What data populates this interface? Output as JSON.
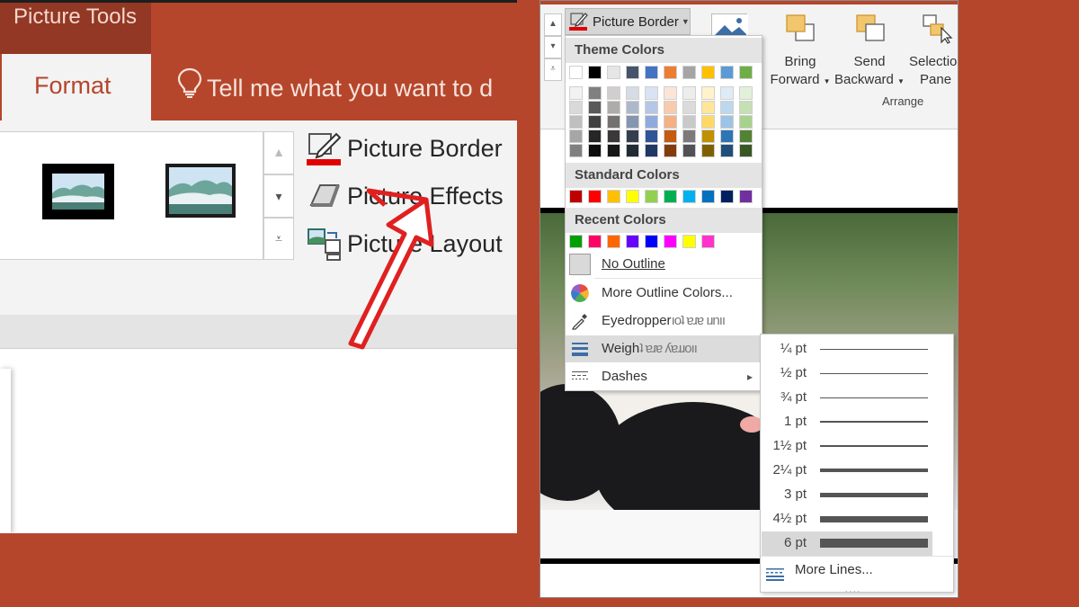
{
  "colors": {
    "accent": "#b5462b",
    "accent_dark": "#933824",
    "ribbon_bg": "#f3f3f3",
    "highlight": "#dcdcdc"
  },
  "left_panel": {
    "contextual_tab": "Picture Tools",
    "active_tab": "Format",
    "tell_me": "Tell me what you want to d",
    "commands": [
      "Picture Border",
      "Picture Effects",
      "Picture Layout"
    ],
    "icons": [
      "lightbulb-icon",
      "picture-border-icon",
      "picture-effects-icon",
      "picture-layout-icon",
      "scroll-up-icon",
      "scroll-down-icon",
      "gallery-more-icon",
      "red-arrow"
    ]
  },
  "right_panel": {
    "picture_border_button": "Picture Border",
    "arrange": {
      "bring_forward": [
        "Bring",
        "Forward"
      ],
      "send_backward": [
        "Send",
        "Backward"
      ],
      "selection_pane": [
        "Selectio",
        "Pane"
      ],
      "group_label": "Arrange"
    },
    "dropdown": {
      "theme_colors_heading": "Theme Colors",
      "theme_top_row": [
        "#ffffff",
        "#000000",
        "#e7e6e6",
        "#44546a",
        "#4472c4",
        "#ed7d31",
        "#a5a5a5",
        "#ffc000",
        "#5b9bd5",
        "#70ad47"
      ],
      "theme_shades": [
        [
          "#f2f2f2",
          "#d9d9d9",
          "#bfbfbf",
          "#a6a6a6",
          "#808080"
        ],
        [
          "#808080",
          "#595959",
          "#404040",
          "#262626",
          "#0d0d0d"
        ],
        [
          "#d0cece",
          "#aeabab",
          "#757171",
          "#3a3838",
          "#171616"
        ],
        [
          "#d6dce4",
          "#adb9ca",
          "#8496b0",
          "#333f4f",
          "#222a35"
        ],
        [
          "#dae3f3",
          "#b4c7e7",
          "#8faadc",
          "#2f5597",
          "#1f3864"
        ],
        [
          "#fbe5d6",
          "#f8cbad",
          "#f4b183",
          "#c55a11",
          "#843c0c"
        ],
        [
          "#ededed",
          "#dbdbdb",
          "#c9c9c9",
          "#7b7b7b",
          "#525252"
        ],
        [
          "#fff2cc",
          "#ffe699",
          "#ffd966",
          "#bf9000",
          "#7f6000"
        ],
        [
          "#deebf7",
          "#bdd7ee",
          "#9dc3e6",
          "#2e75b6",
          "#1f4e79"
        ],
        [
          "#e2f0d9",
          "#c5e0b4",
          "#a9d18e",
          "#548235",
          "#385723"
        ]
      ],
      "standard_colors_heading": "Standard Colors",
      "standard_colors": [
        "#c00000",
        "#ff0000",
        "#ffc000",
        "#ffff00",
        "#92d050",
        "#00b050",
        "#00b0f0",
        "#0070c0",
        "#002060",
        "#7030a0"
      ],
      "recent_colors_heading": "Recent Colors",
      "recent_colors": [
        "#00a000",
        "#ff0066",
        "#ff6600",
        "#6600ff",
        "#0000ff",
        "#ff00ff",
        "#ffff00",
        "#ff33cc"
      ],
      "no_outline": "No Outline",
      "more_outline_colors": "More Outline Colors...",
      "eyedropper": "Eyedropper",
      "eyedropper_rest": "ıoʇ ɐɹɐ ıɹnıı",
      "weight": "Weigh",
      "weight_rest": "ʇ ɐɹɐ ʎɐɹɹoıı",
      "dashes": "Dashes",
      "submenu_arrow": "▸"
    },
    "weights": [
      {
        "label": "¼ pt",
        "pt": 0.25
      },
      {
        "label": "½ pt",
        "pt": 0.5
      },
      {
        "label": "¾ pt",
        "pt": 0.75
      },
      {
        "label": "1 pt",
        "pt": 1
      },
      {
        "label": "1½ pt",
        "pt": 1.5
      },
      {
        "label": "2¼ pt",
        "pt": 2.25
      },
      {
        "label": "3 pt",
        "pt": 3
      },
      {
        "label": "4½ pt",
        "pt": 4.5
      },
      {
        "label": "6 pt",
        "pt": 6,
        "selected": true
      }
    ],
    "more_lines": "More Lines...",
    "grip": "....",
    "menu_icons": [
      "no-outline-icon",
      "color-wheel-icon",
      "eyedropper-icon",
      "weight-icon",
      "dashes-icon",
      "more-lines-icon"
    ]
  }
}
